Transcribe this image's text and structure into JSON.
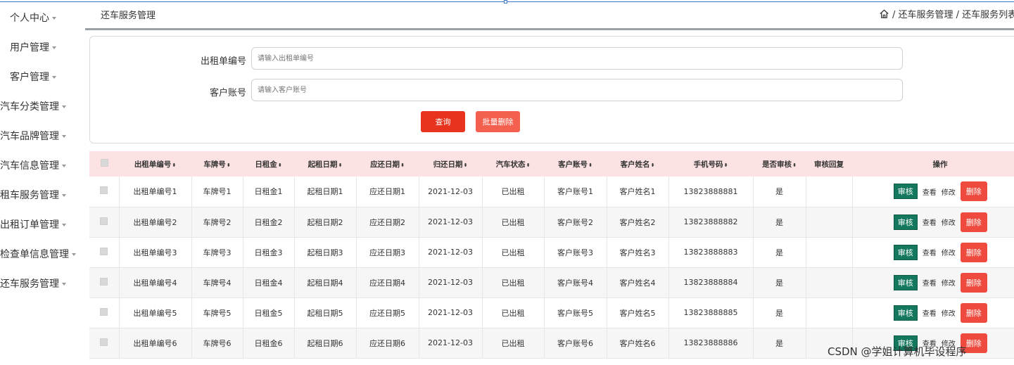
{
  "sidebar": {
    "items": [
      {
        "label": "个人中心"
      },
      {
        "label": "用户管理"
      },
      {
        "label": "客户管理"
      },
      {
        "label": "汽车分类管理"
      },
      {
        "label": "汽车品牌管理"
      },
      {
        "label": "汽车信息管理"
      },
      {
        "label": "租车服务管理"
      },
      {
        "label": "出租订单管理"
      },
      {
        "label": "检查单信息管理"
      },
      {
        "label": "还车服务管理"
      }
    ]
  },
  "header": {
    "title": "还车服务管理",
    "breadcrumb": "/ 还车服务管理 / 还车服务列表",
    "icon": "home-icon"
  },
  "search": {
    "order_label": "出租单编号",
    "order_placeholder": "请输入出租单编号",
    "account_label": "客户账号",
    "account_placeholder": "请输入客户账号",
    "query_button": "查询",
    "batch_delete_button": "批量删除",
    "colors": {
      "query": "#e8331e",
      "batch_delete": "#f4604e"
    }
  },
  "table": {
    "headers": [
      "出租单编号",
      "车牌号",
      "日租金",
      "起租日期",
      "应还日期",
      "归还日期",
      "汽车状态",
      "客户账号",
      "客户姓名",
      "手机号码",
      "是否审核",
      "审核回复",
      "操作"
    ],
    "sort_glyph": "⬍",
    "actions": {
      "audit": "审核",
      "view": "查看",
      "edit": "修改",
      "delete": "删除"
    },
    "rows": [
      {
        "order_no": "出租单编号1",
        "plate": "车牌号1",
        "daily_rent": "日租金1",
        "start_date": "起租日期1",
        "due_date": "应还日期1",
        "return_date": "2021-12-03",
        "status": "已出租",
        "account": "客户账号1",
        "name": "客户姓名1",
        "phone": "13823888881",
        "audited": "是",
        "reply": ""
      },
      {
        "order_no": "出租单编号2",
        "plate": "车牌号2",
        "daily_rent": "日租金2",
        "start_date": "起租日期2",
        "due_date": "应还日期2",
        "return_date": "2021-12-03",
        "status": "已出租",
        "account": "客户账号2",
        "name": "客户姓名2",
        "phone": "13823888882",
        "audited": "是",
        "reply": ""
      },
      {
        "order_no": "出租单编号3",
        "plate": "车牌号3",
        "daily_rent": "日租金3",
        "start_date": "起租日期3",
        "due_date": "应还日期3",
        "return_date": "2021-12-03",
        "status": "已出租",
        "account": "客户账号3",
        "name": "客户姓名3",
        "phone": "13823888883",
        "audited": "是",
        "reply": ""
      },
      {
        "order_no": "出租单编号4",
        "plate": "车牌号4",
        "daily_rent": "日租金4",
        "start_date": "起租日期4",
        "due_date": "应还日期4",
        "return_date": "2021-12-03",
        "status": "已出租",
        "account": "客户账号4",
        "name": "客户姓名4",
        "phone": "13823888884",
        "audited": "是",
        "reply": ""
      },
      {
        "order_no": "出租单编号5",
        "plate": "车牌号5",
        "daily_rent": "日租金5",
        "start_date": "起租日期5",
        "due_date": "应还日期5",
        "return_date": "2021-12-03",
        "status": "已出租",
        "account": "客户账号5",
        "name": "客户姓名5",
        "phone": "13823888885",
        "audited": "是",
        "reply": ""
      },
      {
        "order_no": "出租单编号6",
        "plate": "车牌号6",
        "daily_rent": "日租金6",
        "start_date": "起租日期6",
        "due_date": "应还日期6",
        "return_date": "2021-12-03",
        "status": "已出租",
        "account": "客户账号6",
        "name": "客户姓名6",
        "phone": "13823888886",
        "audited": "是",
        "reply": ""
      }
    ]
  },
  "watermark": "CSDN @学姐计算机毕设程序"
}
